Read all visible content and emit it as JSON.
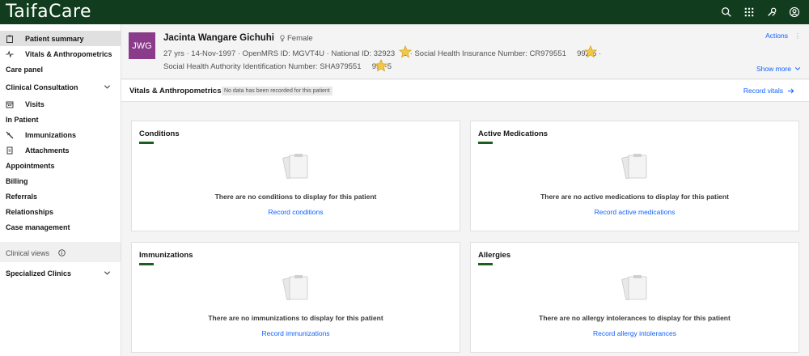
{
  "app": {
    "brand": "TaifaCare"
  },
  "sidebar": {
    "items": [
      {
        "label": "Patient summary"
      },
      {
        "label": "Vitals & Anthropometrics"
      },
      {
        "label": "Care panel"
      },
      {
        "label": "Clinical Consultation"
      },
      {
        "label": "Visits"
      },
      {
        "label": "In Patient"
      },
      {
        "label": "Immunizations"
      },
      {
        "label": "Attachments"
      },
      {
        "label": "Appointments"
      },
      {
        "label": "Billing"
      },
      {
        "label": "Referrals"
      },
      {
        "label": "Relationships"
      },
      {
        "label": "Case management"
      },
      {
        "label": "Clinical views"
      },
      {
        "label": "Specialized Clinics"
      }
    ]
  },
  "patient": {
    "initials": "JWG",
    "name": "Jacinta Wangare Gichuhi",
    "gender": "Female",
    "meta_line1": "27 yrs  ·  14-Nov-1997  ·  OpenMRS ID: MGVT4U  ·  National ID: 32923    3  ·  Social Health Insurance Number: CR979551     992-5  ·",
    "meta_line2": "Social Health Authority Identification Number: SHA979551     992-5",
    "actions_label": "Actions",
    "show_more_label": "Show more"
  },
  "vitals": {
    "title": "Vitals & Anthropometrics",
    "tag": "No data has been recorded for this patient",
    "record_label": "Record vitals"
  },
  "cards": [
    {
      "title": "Conditions",
      "empty_text": "There are no conditions to display for this patient",
      "link": "Record conditions"
    },
    {
      "title": "Active Medications",
      "empty_text": "There are no active medications to display for this patient",
      "link": "Record active medications"
    },
    {
      "title": "Immunizations",
      "empty_text": "There are no immunizations to display for this patient",
      "link": "Record immunizations"
    },
    {
      "title": "Allergies",
      "empty_text": "There are no allergy intolerances to display for this patient",
      "link": "Record allergy intolerances"
    }
  ],
  "colors": {
    "topbar": "#113d1e",
    "accent_link": "#0f62fe",
    "avatar": "#8a3c8a",
    "card_underline": "#1b5e20"
  },
  "icons": {
    "topbar": [
      "search-icon",
      "app-switcher-icon",
      "tools-icon",
      "user-avatar-icon"
    ]
  }
}
